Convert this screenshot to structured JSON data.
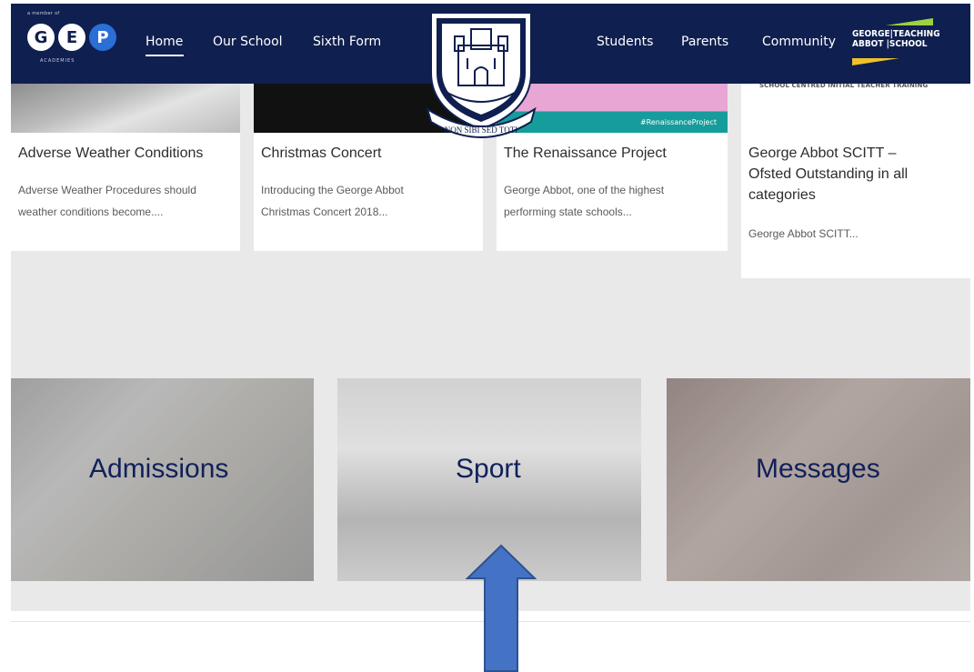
{
  "nav": {
    "gep_logo": {
      "top_text": "a member of",
      "letters": [
        "G",
        "E",
        "P"
      ],
      "bottom_text": "ACADEMIES"
    },
    "links": [
      "Home",
      "Our School",
      "Sixth Form",
      "Students",
      "Parents",
      "Community"
    ],
    "active": "Home",
    "crest_motto": "NON SIBI SED TOTI",
    "right_logo": {
      "line1_left": "GEORGE",
      "line1_right": "TEACHING",
      "line2_left": "ABBOT",
      "line2_right": "SCHOOL"
    }
  },
  "cards": [
    {
      "title": "Adverse Weather Conditions",
      "excerpt_line1": "Adverse Weather Procedures should",
      "excerpt_line2": "weather conditions become...."
    },
    {
      "title": "Christmas Concert",
      "excerpt_line1": "Introducing the George Abbot",
      "excerpt_line2": "Christmas Concert 2018..."
    },
    {
      "title": "The Renaissance Project",
      "excerpt_line1": "George Abbot, one of the highest",
      "excerpt_line2": "performing state schools...",
      "image_tag": "#RenaissanceProject"
    },
    {
      "title_line1": "George Abbot SCITT –",
      "title_line2": "Ofsted Outstanding in all",
      "title_line3": "categories",
      "excerpt_line1": "George Abbot SCITT...",
      "image_caption": "SCHOOL CENTRED INITIAL TEACHER TRAINING"
    }
  ],
  "tiles": [
    "Admissions",
    "Sport",
    "Messages"
  ],
  "colors": {
    "navbar": "#0f1f4f",
    "tile_text": "#10205a",
    "arrow": "#4472c4",
    "content_bg": "#e9e9e9"
  }
}
